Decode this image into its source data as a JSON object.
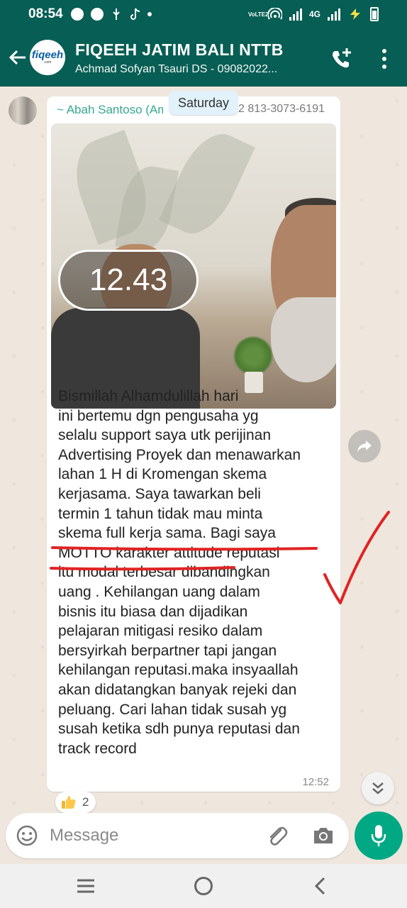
{
  "status_bar": {
    "time": "08:54",
    "network_label": "4G",
    "volte_label": "VoLTE2",
    "battery_icon": "battery-icon"
  },
  "header": {
    "group_name": "FIQEEH JATIM BALI NTTB",
    "subtitle": "Achmad Sofyan Tsauri DS - 09082022...",
    "logo_text": "fiqeeh",
    "logo_sub": ".com"
  },
  "chat": {
    "date_chip": "Saturday",
    "message": {
      "sender_name": "~ Abah Santoso (Am...",
      "sender_phone": "2 813-3073-6191",
      "photo_timer": "12.43",
      "text": "Bismillah Alhamdulillah hari\nini bertemu dgn pengusaha yg\nselalu support saya utk perijinan\nAdvertising Proyek dan menawarkan\nlahan 1 H di Kromengan skema\nkerjasama. Saya tawarkan beli\ntermin 1 tahun tidak mau minta\nskema full kerja sama. Bagi saya\nMOTTO karakter attitude reputasi\nitu modal terbesar dibandingkan\nuang  . Kehilangan uang dalam\nbisnis itu biasa dan dijadikan\npelajaran mitigasi resiko dalam\nbersyirkah berpartner tapi jangan\nkehilangan reputasi.maka insyaallah\nakan didatangkan banyak rejeki dan\npeluang. Cari lahan tidak susah yg\nsusah ketika sdh punya reputasi dan\ntrack record",
      "time": "12:52",
      "reaction_count": "2"
    }
  },
  "input": {
    "placeholder": "Message"
  },
  "colors": {
    "header_bg": "#075e54",
    "accent": "#00a884",
    "sender_name": "#35a88f",
    "annotation_red": "#e02424"
  }
}
